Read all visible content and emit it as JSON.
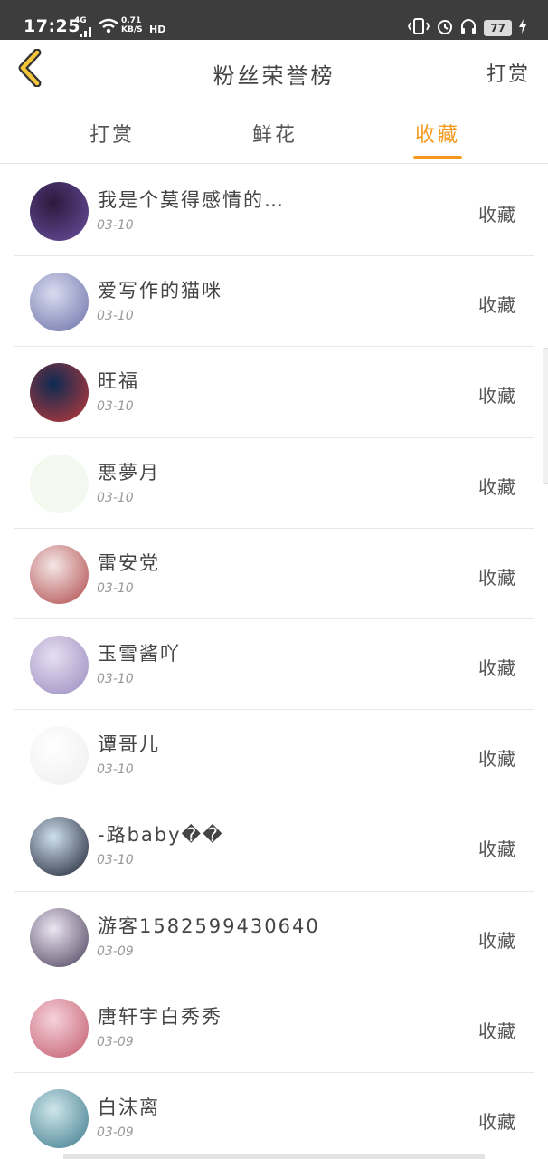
{
  "status": {
    "time": "17:25",
    "network": "4G",
    "speed_value": "0.71",
    "speed_unit": "KB/S",
    "hd": "HD",
    "battery": "77"
  },
  "header": {
    "title": "粉丝荣誉榜",
    "action": "打赏"
  },
  "tabs": [
    {
      "label": "打赏",
      "active": false
    },
    {
      "label": "鲜花",
      "active": false
    },
    {
      "label": "收藏",
      "active": true
    }
  ],
  "colors": {
    "accent": "#f39a1e",
    "status_bar": "#3d3d3d"
  },
  "icons": {
    "back": "chevron-left-icon"
  },
  "list": [
    {
      "name": "我是个莫得感情的…",
      "date": "03-10",
      "type": "收藏",
      "avatar": [
        "#2b1a3d",
        "#6a4fa0"
      ]
    },
    {
      "name": "爱写作的猫咪",
      "date": "03-10",
      "type": "收藏",
      "avatar": [
        "#d9dcef",
        "#6a6fa8"
      ]
    },
    {
      "name": "旺福",
      "date": "03-10",
      "type": "收藏",
      "avatar": [
        "#0d2a52",
        "#c23a3a"
      ]
    },
    {
      "name": "悪夢月",
      "date": "03-10",
      "type": "收藏",
      "avatar": [
        "#f3f9ee",
        "#f3f9ee"
      ]
    },
    {
      "name": "雷安党",
      "date": "03-10",
      "type": "收藏",
      "avatar": [
        "#f4e6e6",
        "#b04848"
      ]
    },
    {
      "name": "玉雪酱吖",
      "date": "03-10",
      "type": "收藏",
      "avatar": [
        "#e6dff0",
        "#9a8ac0"
      ]
    },
    {
      "name": "谭哥儿",
      "date": "03-10",
      "type": "收藏",
      "avatar": [
        "#ffffff",
        "#eeeeee"
      ]
    },
    {
      "name": "-路baby��",
      "date": "03-10",
      "type": "收藏",
      "avatar": [
        "#cfe0ee",
        "#1a2030"
      ]
    },
    {
      "name": "游客1582599430640",
      "date": "03-09",
      "type": "收藏",
      "avatar": [
        "#ece6f2",
        "#4a3f5a"
      ]
    },
    {
      "name": "唐轩宇白秀秀",
      "date": "03-09",
      "type": "收藏",
      "avatar": [
        "#f6d2dc",
        "#c25a6a"
      ]
    },
    {
      "name": "白沫离",
      "date": "03-09",
      "type": "收藏",
      "avatar": [
        "#cfe6ea",
        "#3d7a8c"
      ]
    }
  ]
}
